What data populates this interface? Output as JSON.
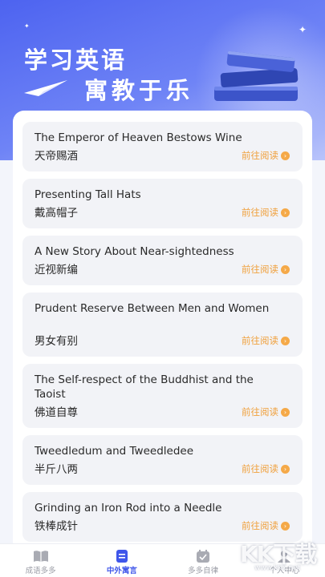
{
  "hero": {
    "title": "学习英语",
    "subtitle": "寓教于乐"
  },
  "cards": [
    {
      "en": "The Emperor of Heaven Bestows Wine",
      "cn": "天帝赐酒",
      "link": "前往阅读"
    },
    {
      "en": "Presenting Tall Hats",
      "cn": "戴高帽子",
      "link": "前往阅读"
    },
    {
      "en": "A New Story About Near-sightedness",
      "cn": "近视新编",
      "link": "前往阅读"
    },
    {
      "en": "Prudent Reserve Between Men and Women",
      "cn": "男女有别",
      "link": "前往阅读"
    },
    {
      "en": "The Self-respect of the Buddhist and the Taoist",
      "cn": "佛道自尊",
      "link": "前往阅读"
    },
    {
      "en": "Tweedledum and Tweedledee",
      "cn": "半斤八两",
      "link": "前往阅读"
    },
    {
      "en": "Grinding an Iron Rod into a Needle",
      "cn": "铁棒成针",
      "link": "前往阅读"
    }
  ],
  "tabs": [
    {
      "label": "成语多多",
      "icon": "book-icon",
      "active": false
    },
    {
      "label": "中外寓言",
      "icon": "fable-icon",
      "active": true
    },
    {
      "label": "多多自律",
      "icon": "calendar-check-icon",
      "active": false
    },
    {
      "label": "个人中心",
      "icon": "user-icon",
      "active": false
    }
  ],
  "watermark": {
    "text": "KK下载",
    "url": "www.kkx.net"
  },
  "colors": {
    "accent": "#3f56ea",
    "link": "#f0a03c",
    "hero_start": "#4d63f0"
  }
}
